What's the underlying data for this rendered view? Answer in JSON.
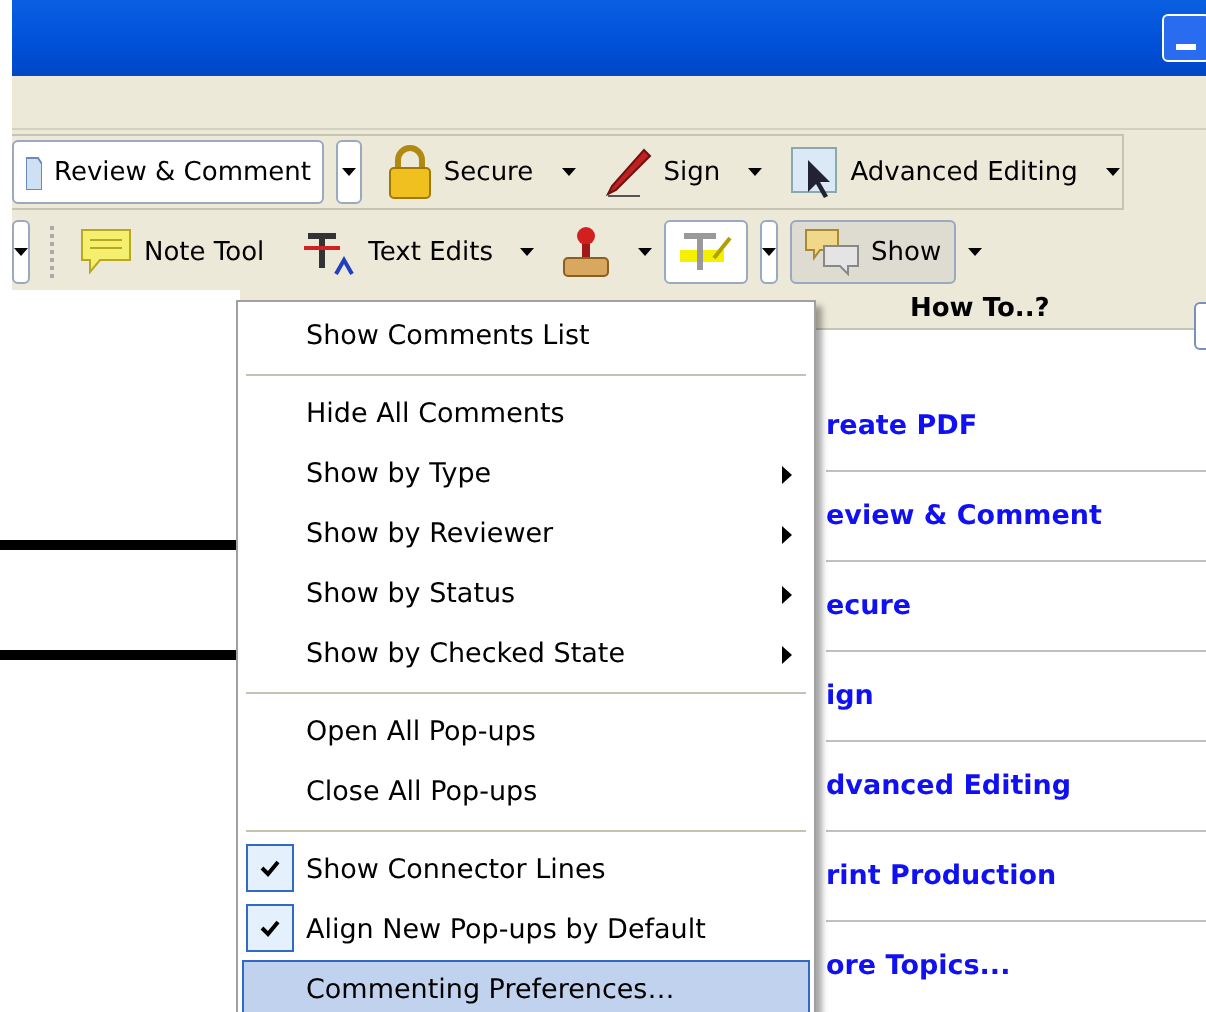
{
  "toolbar_row_1": [
    {
      "kind": "framed",
      "label": "Review & Comment"
    },
    {
      "kind": "plain",
      "label": "Secure"
    },
    {
      "kind": "plain",
      "label": "Sign"
    },
    {
      "kind": "plain",
      "label": "Advanced Editing"
    }
  ],
  "toolbar_row_2": [
    {
      "kind": "plain",
      "label": "Note Tool",
      "dropdown": false
    },
    {
      "kind": "plain",
      "label": "Text Edits",
      "dropdown": true
    },
    {
      "kind": "icon",
      "dropdown": true
    },
    {
      "kind": "framed",
      "dropdown": true
    },
    {
      "kind": "pressed",
      "label": "Show",
      "dropdown": true
    }
  ],
  "how_to": {
    "title": "How To..?",
    "links": [
      "reate PDF",
      "eview & Comment",
      "ecure",
      "ign",
      "dvanced Editing",
      "rint Production",
      "ore Topics..."
    ]
  },
  "menu": [
    [
      {
        "label": "Show Comments List",
        "submenu": false
      }
    ],
    [
      {
        "label": "Hide All Comments",
        "submenu": false
      },
      {
        "label": "Show by Type",
        "submenu": true
      },
      {
        "label": "Show by Reviewer",
        "submenu": true
      },
      {
        "label": "Show by Status",
        "submenu": true
      },
      {
        "label": "Show by Checked State",
        "submenu": true
      }
    ],
    [
      {
        "label": "Open All Pop-ups",
        "submenu": false
      },
      {
        "label": "Close All Pop-ups",
        "submenu": false
      }
    ],
    [
      {
        "label": "Show Connector Lines",
        "checked": true,
        "selected": false
      },
      {
        "label": "Align New Pop-ups by Default",
        "checked": true,
        "selected": false
      },
      {
        "label": "Commenting Preferences…",
        "checked": false,
        "selected": true
      }
    ]
  ]
}
